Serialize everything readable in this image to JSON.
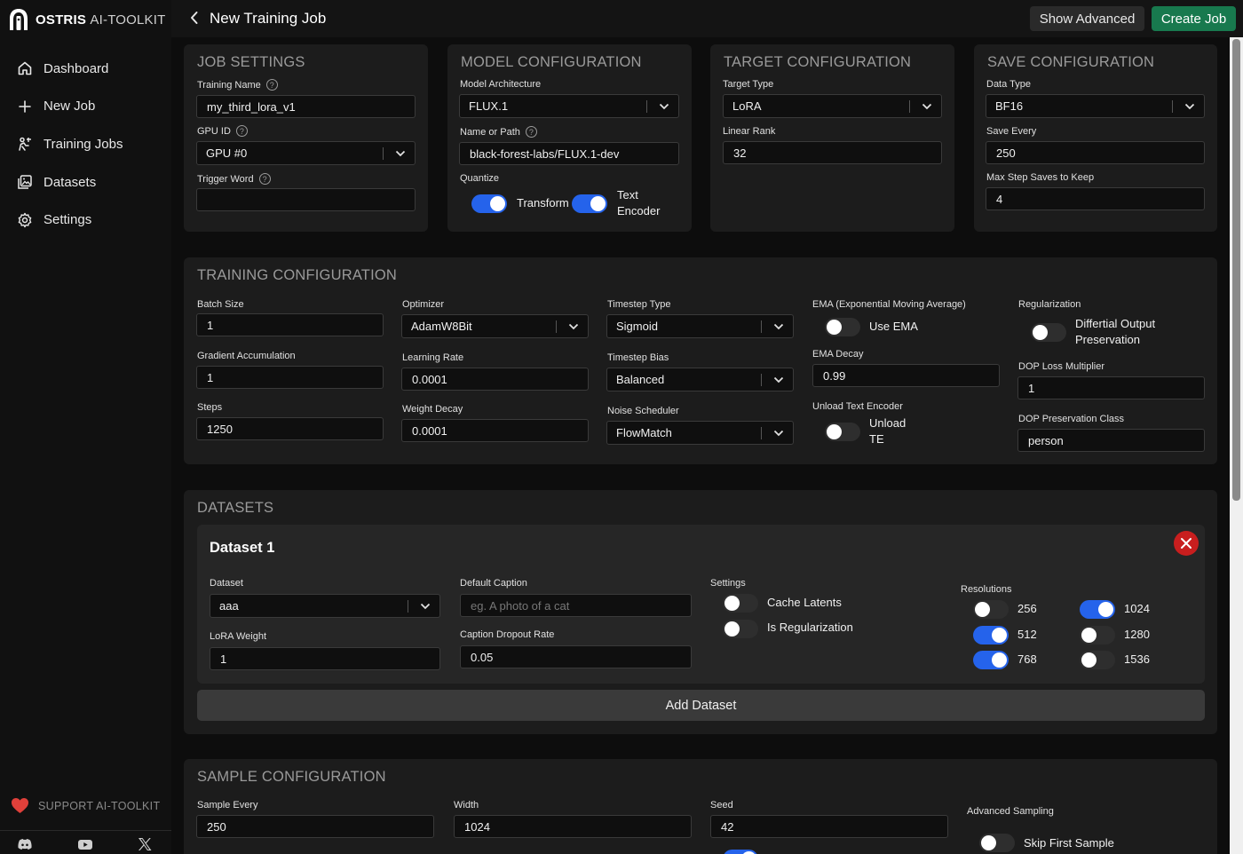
{
  "brand": {
    "name_bold": "OSTRIS",
    "name_thin": "AI-TOOLKIT"
  },
  "sidebar": {
    "items": [
      {
        "label": "Dashboard",
        "icon": "home-icon"
      },
      {
        "label": "New Job",
        "icon": "plus-icon"
      },
      {
        "label": "Training Jobs",
        "icon": "training-jobs-icon"
      },
      {
        "label": "Datasets",
        "icon": "image-icon"
      },
      {
        "label": "Settings",
        "icon": "gear-icon"
      }
    ],
    "support_label": "SUPPORT AI-TOOLKIT",
    "social": [
      "discord-icon",
      "youtube-icon",
      "x-icon"
    ]
  },
  "header": {
    "title": "New Training Job",
    "show_advanced": "Show Advanced",
    "create_job": "Create Job"
  },
  "job_settings": {
    "title": "JOB SETTINGS",
    "training_name_label": "Training Name",
    "training_name_value": "my_third_lora_v1",
    "gpu_id_label": "GPU ID",
    "gpu_id_value": "GPU #0",
    "trigger_word_label": "Trigger Word",
    "trigger_word_value": ""
  },
  "model_config": {
    "title": "MODEL CONFIGURATION",
    "arch_label": "Model Architecture",
    "arch_value": "FLUX.1",
    "path_label": "Name or Path",
    "path_value": "black-forest-labs/FLUX.1-dev",
    "quantize_label": "Quantize",
    "quantize_transformer": "Transform",
    "quantize_transformer_on": true,
    "quantize_te_line1": "Text",
    "quantize_te_line2": "Encoder",
    "quantize_te_on": true
  },
  "target_config": {
    "title": "TARGET CONFIGURATION",
    "type_label": "Target Type",
    "type_value": "LoRA",
    "rank_label": "Linear Rank",
    "rank_value": "32"
  },
  "save_config": {
    "title": "SAVE CONFIGURATION",
    "dtype_label": "Data Type",
    "dtype_value": "BF16",
    "every_label": "Save Every",
    "every_value": "250",
    "max_label": "Max Step Saves to Keep",
    "max_value": "4"
  },
  "training_config": {
    "title": "TRAINING CONFIGURATION",
    "batch_label": "Batch Size",
    "batch_value": "1",
    "grad_label": "Gradient Accumulation",
    "grad_value": "1",
    "steps_label": "Steps",
    "steps_value": "1250",
    "optimizer_label": "Optimizer",
    "optimizer_value": "AdamW8Bit",
    "lr_label": "Learning Rate",
    "lr_value": "0.0001",
    "wd_label": "Weight Decay",
    "wd_value": "0.0001",
    "ts_type_label": "Timestep Type",
    "ts_type_value": "Sigmoid",
    "ts_bias_label": "Timestep Bias",
    "ts_bias_value": "Balanced",
    "scheduler_label": "Noise Scheduler",
    "scheduler_value": "FlowMatch",
    "ema_label": "EMA (Exponential Moving Average)",
    "ema_toggle": "Use EMA",
    "ema_on": false,
    "ema_decay_label": "EMA Decay",
    "ema_decay_value": "0.99",
    "unload_label": "Unload Text Encoder",
    "unload_line1": "Unload",
    "unload_line2": "TE",
    "unload_on": false,
    "reg_label": "Regularization",
    "reg_line1": "Differtial Output",
    "reg_line2": "Preservation",
    "reg_on": false,
    "dop_mult_label": "DOP Loss Multiplier",
    "dop_mult_value": "1",
    "dop_class_label": "DOP Preservation Class",
    "dop_class_value": "person"
  },
  "datasets": {
    "title": "DATASETS",
    "dataset1": {
      "title": "Dataset 1",
      "dataset_label": "Dataset",
      "dataset_value": "aaa",
      "lora_weight_label": "LoRA Weight",
      "lora_weight_value": "1",
      "caption_label": "Default Caption",
      "caption_placeholder": "eg. A photo of a cat",
      "dropout_label": "Caption Dropout Rate",
      "dropout_value": "0.05",
      "settings_label": "Settings",
      "cache_latents": "Cache Latents",
      "cache_latents_on": false,
      "is_reg": "Is Regularization",
      "is_reg_on": false,
      "resolutions_label": "Resolutions",
      "resolutions": [
        {
          "value": "256",
          "on": false
        },
        {
          "value": "512",
          "on": true
        },
        {
          "value": "768",
          "on": true
        },
        {
          "value": "1024",
          "on": true
        },
        {
          "value": "1280",
          "on": false
        },
        {
          "value": "1536",
          "on": false
        }
      ]
    },
    "add_dataset": "Add Dataset"
  },
  "sample_config": {
    "title": "SAMPLE CONFIGURATION",
    "every_label": "Sample Every",
    "every_value": "250",
    "width_label": "Width",
    "width_value": "1024",
    "seed_label": "Seed",
    "seed_value": "42",
    "adv_label": "Advanced Sampling",
    "skip_first": "Skip First Sample",
    "skip_first_on": false
  },
  "colors": {
    "accent_blue": "#2563eb",
    "create_green": "#18794e",
    "danger_red": "#c81e1e",
    "heart_red": "#e0403a"
  }
}
